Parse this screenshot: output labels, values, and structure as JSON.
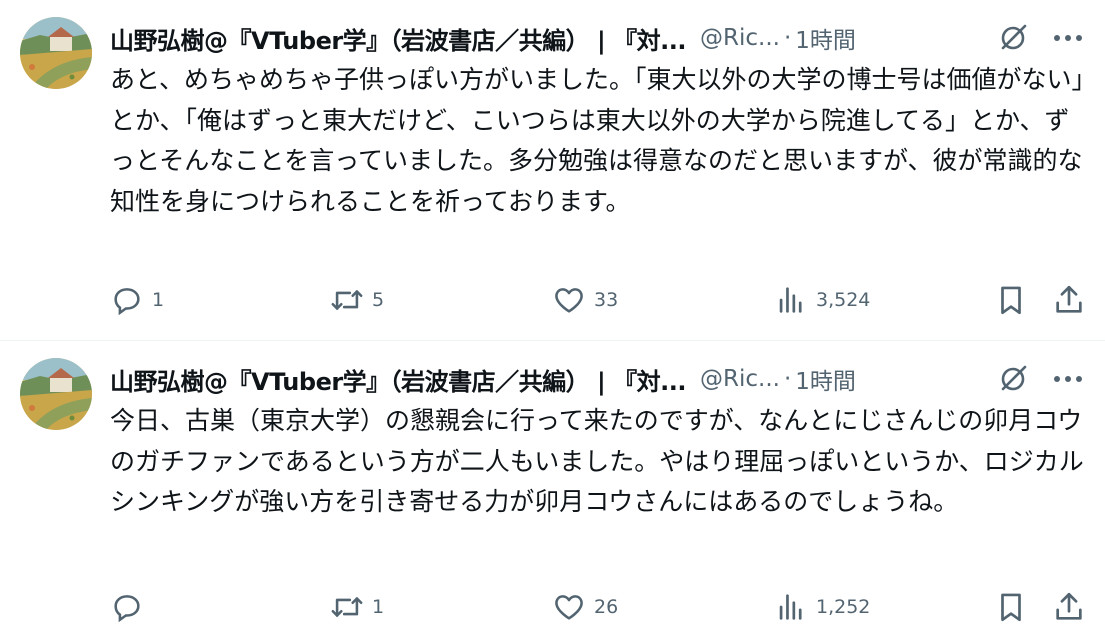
{
  "tweets": [
    {
      "author_name": "山野弘樹@『VTuber学』（岩波書店／共編） | 『対...",
      "handle": "@Ric...",
      "separator": "·",
      "time": "1時間",
      "text": "あと、めちゃめちゃ子供っぽい方がいました。「東大以外の大学の博士号は価値がない」とか、「俺はずっと東大だけど、こいつらは東大以外の大学から院進してる」とか、ずっとそんなことを言っていました。多分勉強は得意なのだと思いますが、彼が常識的な知性を身につけられることを祈っております。",
      "replies": "1",
      "retweets": "5",
      "likes": "33",
      "views": "3,524"
    },
    {
      "author_name": "山野弘樹@『VTuber学』（岩波書店／共編） | 『対...",
      "handle": "@Ric...",
      "separator": "·",
      "time": "1時間",
      "text": "今日、古巣（東京大学）の懇親会に行って来たのですが、なんとにじさんじの卯月コウのガチファンであるという方が二人もいました。やはり理屈っぽいというか、ロジカルシンキングが強い方を引き寄せる力が卯月コウさんにはあるのでしょうね。",
      "replies": "",
      "retweets": "1",
      "likes": "26",
      "views": "1,252"
    }
  ],
  "icons": {
    "reply": "reply-icon",
    "retweet": "retweet-icon",
    "like": "like-icon",
    "views": "views-icon",
    "bookmark": "bookmark-icon",
    "share": "share-icon",
    "grok": "grok-icon",
    "more": "more-icon"
  },
  "colors": {
    "text": "#0f1419",
    "secondary": "#536471",
    "divider": "#eff3f4"
  }
}
